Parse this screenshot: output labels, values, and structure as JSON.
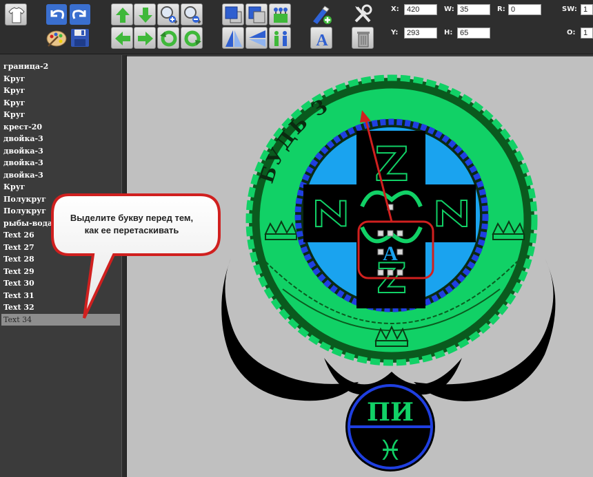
{
  "toolbar": {
    "icons": [
      "shirt-icon",
      "undo-icon",
      "redo-icon",
      "move-up-icon",
      "move-down-icon",
      "zoom-in-icon",
      "zoom-out-icon",
      "bring-front-icon",
      "send-back-icon",
      "group-icon",
      "add-object-icon",
      "tools-icon",
      "palette-icon",
      "save-icon",
      "move-left-icon",
      "move-right-icon",
      "rotate-left-icon",
      "rotate-right-icon",
      "flip-vertical-icon",
      "flip-horizontal-icon",
      "mirror-figures-icon",
      "text-icon",
      "trash-icon"
    ],
    "props": {
      "x_label": "X:",
      "x_value": "420",
      "w_label": "W:",
      "w_value": "35",
      "r_label": "R:",
      "r_value": "0",
      "sw_label": "SW:",
      "sw_value": "1",
      "y_label": "Y:",
      "y_value": "293",
      "h_label": "H:",
      "h_value": "65",
      "o_label": "O:",
      "o_value": "1"
    }
  },
  "layers": [
    "граница-2",
    "Круг",
    "Круг",
    "Круг",
    "Круг",
    "крест-20",
    "двойка-3",
    "двойка-3",
    "двойка-3",
    "двойка-3",
    "Круг",
    "Полукруг",
    "Полукруг",
    "рыбы-вода-",
    "Text 26",
    "Text 27",
    "Text 28",
    "Text 29",
    "Text 30",
    "Text 31",
    "Text 32",
    "Text 34"
  ],
  "selected_layer": "Text 34",
  "tooltip": {
    "line1": "Выделите букву перед тем,",
    "line2": "как ее перетаскивать"
  },
  "artwork": {
    "ring_text": "БУДЬ З",
    "center_letter": "A",
    "glyph": "Z",
    "pendant_top": "ПИ",
    "pendant_bottom": "♓"
  },
  "colors": {
    "toolbar_bg": "#2e2e2e",
    "canvas_bg": "#c0c0c0",
    "outer_ring": "#11d166",
    "outer_ring_dark": "#0a5a1e",
    "inner_blue": "#1aa3ef",
    "dotted_ring": "#1f3fe0",
    "highlight_red": "#d0201f",
    "selected_row": "#8e8e8e"
  }
}
